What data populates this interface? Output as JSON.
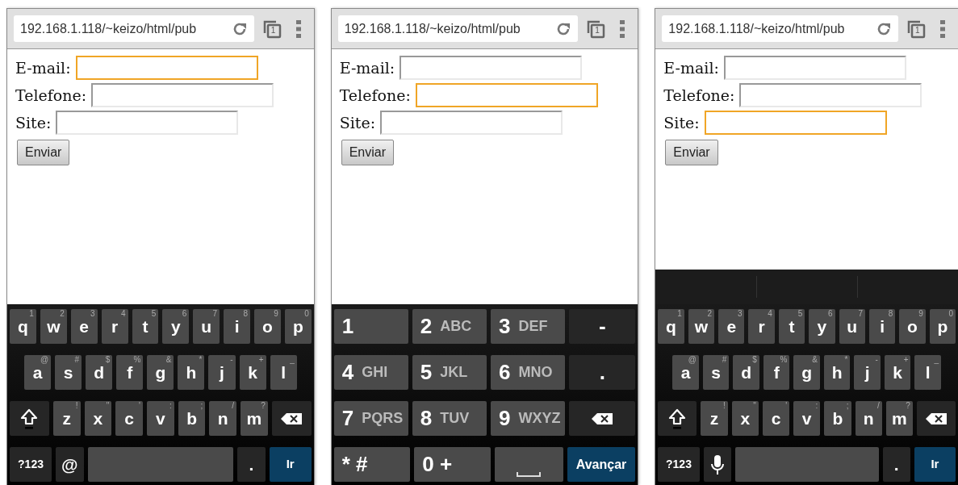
{
  "phones": [
    {
      "url": "192.168.1.118/~keizo/html/pub",
      "tab_count": "1",
      "fields": [
        {
          "label": "E-mail:",
          "focused": true
        },
        {
          "label": "Telefone:",
          "focused": false
        },
        {
          "label": "Site:",
          "focused": false
        }
      ],
      "submit": "Enviar",
      "suggestion_strip": false,
      "keyboard": {
        "kind": "qwerty",
        "rows": [
          {
            "keys": [
              {
                "kind": "char",
                "label": "q",
                "hint": "1"
              },
              {
                "kind": "char",
                "label": "w",
                "hint": "2"
              },
              {
                "kind": "char",
                "label": "e",
                "hint": "3"
              },
              {
                "kind": "char",
                "label": "r",
                "hint": "4"
              },
              {
                "kind": "char",
                "label": "t",
                "hint": "5"
              },
              {
                "kind": "char",
                "label": "y",
                "hint": "6"
              },
              {
                "kind": "char",
                "label": "u",
                "hint": "7"
              },
              {
                "kind": "char",
                "label": "i",
                "hint": "8"
              },
              {
                "kind": "char",
                "label": "o",
                "hint": "9"
              },
              {
                "kind": "char",
                "label": "p",
                "hint": "0"
              }
            ]
          },
          {
            "keys": [
              {
                "kind": "char",
                "label": "a",
                "hint": "@"
              },
              {
                "kind": "char",
                "label": "s",
                "hint": "#"
              },
              {
                "kind": "char",
                "label": "d",
                "hint": "$"
              },
              {
                "kind": "char",
                "label": "f",
                "hint": "%"
              },
              {
                "kind": "char",
                "label": "g",
                "hint": "&"
              },
              {
                "kind": "char",
                "label": "h",
                "hint": "*"
              },
              {
                "kind": "char",
                "label": "j",
                "hint": "-"
              },
              {
                "kind": "char",
                "label": "k",
                "hint": "+"
              },
              {
                "kind": "char",
                "label": "l",
                "hint": "_"
              }
            ]
          },
          {
            "keys": [
              {
                "kind": "shift"
              },
              {
                "kind": "char",
                "label": "z",
                "hint": "!"
              },
              {
                "kind": "char",
                "label": "x",
                "hint": "\""
              },
              {
                "kind": "char",
                "label": "c",
                "hint": "'"
              },
              {
                "kind": "char",
                "label": "v",
                "hint": ":"
              },
              {
                "kind": "char",
                "label": "b",
                "hint": ";"
              },
              {
                "kind": "char",
                "label": "n",
                "hint": "/"
              },
              {
                "kind": "char",
                "label": "m",
                "hint": "?"
              },
              {
                "kind": "backspace"
              }
            ]
          },
          {
            "keys": [
              {
                "kind": "mode",
                "label": "?123"
              },
              {
                "kind": "function",
                "label": "@"
              },
              {
                "kind": "space"
              },
              {
                "kind": "function",
                "label": "."
              },
              {
                "kind": "action",
                "label": "Ir"
              }
            ]
          }
        ]
      }
    },
    {
      "url": "192.168.1.118/~keizo/html/pub",
      "tab_count": "1",
      "fields": [
        {
          "label": "E-mail:",
          "focused": false
        },
        {
          "label": "Telefone:",
          "focused": true
        },
        {
          "label": "Site:",
          "focused": false
        }
      ],
      "submit": "Enviar",
      "suggestion_strip": false,
      "keyboard": {
        "kind": "numeric",
        "rows": [
          {
            "keys": [
              {
                "kind": "char",
                "label": "1"
              },
              {
                "kind": "char",
                "label": "2",
                "letters": "ABC"
              },
              {
                "kind": "char",
                "label": "3",
                "letters": "DEF"
              },
              {
                "kind": "function",
                "label": "-"
              }
            ]
          },
          {
            "keys": [
              {
                "kind": "char",
                "label": "4",
                "letters": "GHI"
              },
              {
                "kind": "char",
                "label": "5",
                "letters": "JKL"
              },
              {
                "kind": "char",
                "label": "6",
                "letters": "MNO"
              },
              {
                "kind": "function",
                "label": "."
              }
            ]
          },
          {
            "keys": [
              {
                "kind": "char",
                "label": "7",
                "letters": "PQRS"
              },
              {
                "kind": "char",
                "label": "8",
                "letters": "TUV"
              },
              {
                "kind": "char",
                "label": "9",
                "letters": "WXYZ"
              },
              {
                "kind": "backspace"
              }
            ]
          },
          {
            "keys": [
              {
                "kind": "char",
                "label": "* #"
              },
              {
                "kind": "char",
                "label": "0 +"
              },
              {
                "kind": "space"
              },
              {
                "kind": "action",
                "label": "Avançar"
              }
            ]
          }
        ]
      }
    },
    {
      "url": "192.168.1.118/~keizo/html/pub",
      "tab_count": "1",
      "fields": [
        {
          "label": "E-mail:",
          "focused": false
        },
        {
          "label": "Telefone:",
          "focused": false
        },
        {
          "label": "Site:",
          "focused": true
        }
      ],
      "submit": "Enviar",
      "suggestion_strip": true,
      "keyboard": {
        "kind": "qwerty",
        "rows": [
          {
            "keys": [
              {
                "kind": "char",
                "label": "q",
                "hint": "1"
              },
              {
                "kind": "char",
                "label": "w",
                "hint": "2"
              },
              {
                "kind": "char",
                "label": "e",
                "hint": "3"
              },
              {
                "kind": "char",
                "label": "r",
                "hint": "4"
              },
              {
                "kind": "char",
                "label": "t",
                "hint": "5"
              },
              {
                "kind": "char",
                "label": "y",
                "hint": "6"
              },
              {
                "kind": "char",
                "label": "u",
                "hint": "7"
              },
              {
                "kind": "char",
                "label": "i",
                "hint": "8"
              },
              {
                "kind": "char",
                "label": "o",
                "hint": "9"
              },
              {
                "kind": "char",
                "label": "p",
                "hint": "0"
              }
            ]
          },
          {
            "keys": [
              {
                "kind": "char",
                "label": "a",
                "hint": "@"
              },
              {
                "kind": "char",
                "label": "s",
                "hint": "#"
              },
              {
                "kind": "char",
                "label": "d",
                "hint": "$"
              },
              {
                "kind": "char",
                "label": "f",
                "hint": "%"
              },
              {
                "kind": "char",
                "label": "g",
                "hint": "&"
              },
              {
                "kind": "char",
                "label": "h",
                "hint": "*"
              },
              {
                "kind": "char",
                "label": "j",
                "hint": "-"
              },
              {
                "kind": "char",
                "label": "k",
                "hint": "+"
              },
              {
                "kind": "char",
                "label": "l",
                "hint": "_"
              }
            ]
          },
          {
            "keys": [
              {
                "kind": "shift"
              },
              {
                "kind": "char",
                "label": "z",
                "hint": "!"
              },
              {
                "kind": "char",
                "label": "x",
                "hint": "\""
              },
              {
                "kind": "char",
                "label": "c",
                "hint": "'"
              },
              {
                "kind": "char",
                "label": "v",
                "hint": ":"
              },
              {
                "kind": "char",
                "label": "b",
                "hint": ";"
              },
              {
                "kind": "char",
                "label": "n",
                "hint": "/"
              },
              {
                "kind": "char",
                "label": "m",
                "hint": "?"
              },
              {
                "kind": "backspace"
              }
            ]
          },
          {
            "keys": [
              {
                "kind": "mode",
                "label": "?123"
              },
              {
                "kind": "mic"
              },
              {
                "kind": "space"
              },
              {
                "kind": "function",
                "label": "."
              },
              {
                "kind": "action",
                "label": "Ir"
              }
            ]
          }
        ]
      }
    }
  ]
}
